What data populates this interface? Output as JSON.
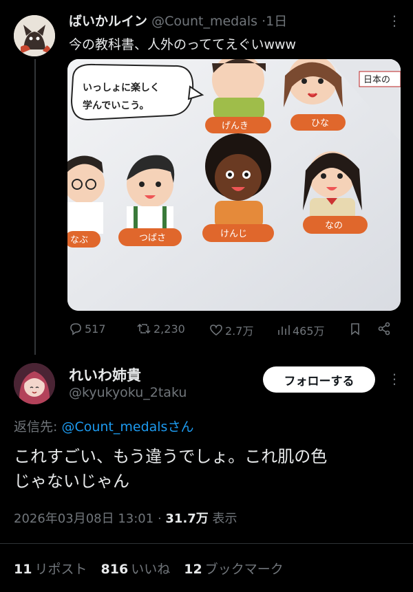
{
  "tweet": {
    "display_name": "ばいかルイン",
    "handle": "@Count_medals",
    "separator": "·",
    "time": "1日",
    "text": "今の教科書、人外のっててえぐいwww",
    "image": {
      "speech_bubble": "いっしょに楽しく\n学んでいこう。",
      "book_label": "日本の",
      "characters": [
        "げんき",
        "ひな",
        "なぶ",
        "つばさ",
        "けんじ",
        "なの"
      ]
    },
    "actions": {
      "replies": "517",
      "retweets": "2,230",
      "likes": "2.7万",
      "views": "465万"
    }
  },
  "reply": {
    "display_name": "れいわ姉貴",
    "handle": "@kyukyoku_2taku",
    "follow_label": "フォローする",
    "reply_to_prefix": "返信先: ",
    "reply_to_mention": "@Count_medalsさん",
    "text_line1": "これすごい、もう違うでしょ。これ肌の色",
    "text_line2": "じゃないじゃん",
    "datetime": "2026年03月08日 13:01",
    "meta_sep": " · ",
    "views_count": "31.7万",
    "views_label": " 表示",
    "stats": {
      "reposts_count": "11",
      "reposts_label": "リポスト",
      "likes_count": "816",
      "likes_label": "いいね",
      "bookmarks_count": "12",
      "bookmarks_label": "ブックマーク"
    }
  },
  "colors": {
    "background": "#000000",
    "text": "#e7e9ea",
    "muted": "#71767b",
    "link": "#1d9bf0",
    "label_orange": "#e0672c"
  }
}
